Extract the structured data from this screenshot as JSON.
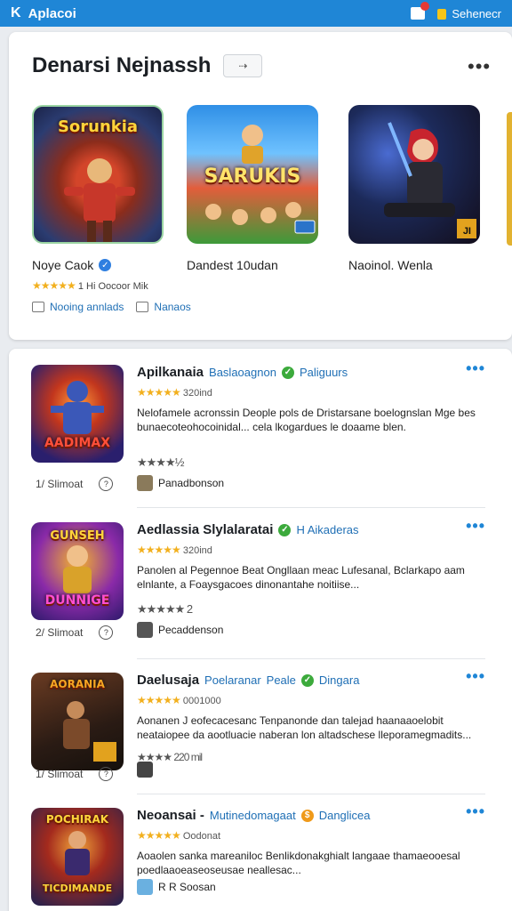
{
  "topbar": {
    "title": "Aplacoi",
    "right_label": "Sehenecr"
  },
  "featured": {
    "title": "Denarsi Nejnassh",
    "chip": "⇢",
    "games": [
      {
        "art_text": "Sorunkia",
        "name": "Noye Caok",
        "rating": "1 Hi Oocoor Mik"
      },
      {
        "art_text": "SARUKIS",
        "name": "Dandest 10udan",
        "rating": ""
      },
      {
        "art_text": "",
        "name": "Naoinol. Wenla",
        "rating": ""
      }
    ],
    "links": [
      "Nooing annlads",
      "Nanaos"
    ]
  },
  "list": [
    {
      "art_text": "AADIMAX",
      "title": "Apilkanaia",
      "tag1": "Baslaoagnon",
      "tag2": "Paliguurs",
      "count": "320ind",
      "desc": "Nelofamele acronssin Deople pols de Dristarsane boelognslan Mge bes bunaecoteohocoinidal... cela lkogardues le doaame blen.",
      "rate2": "★★★★½",
      "author": "Panadbonson",
      "meta_left": "1/ Slimoat"
    },
    {
      "art_text": "DUNNIGE",
      "title": "Aedlassia Slylalaratai",
      "tag1": "",
      "tag2": "H Aikaderas",
      "count": "320ind",
      "desc": "Panolen al Pegennoe Beat Ongllaan meac Lufesanal, Bclarkapo aam elnlante, a Foaysgacoes dinonantahe noitiise...",
      "rate2": "★★★★★ 2",
      "author": "Pecaddenson",
      "meta_left": "2/ Slimoat"
    },
    {
      "art_text": "AORANIA",
      "title": "Daelusaja",
      "tag1": "Poelaranar",
      "tag2": "Peale",
      "tag3": "Dingara",
      "count": "0001000",
      "desc": "Aonanen J eofecacesanc Tenpanonde dan talejad haanaaoelobit neataiopee da aootluacie naberan lon altadschese lleporamegmadits...",
      "rate2": "★★★★ 220 mil",
      "author": "",
      "meta_left": "1/ Slimoat"
    },
    {
      "art_text": "TICDIMANDE",
      "title": "Neoansai -",
      "tag1": "Mutinedomagaat",
      "tag2": "Danglicea",
      "count": "Oodonat",
      "desc": "Aoaolen sanka mareaniloc Benlikdonakghialt langaae thamaeooesal poedlaaoeaseoseusae neallesac...",
      "rate2": "R R Soosan",
      "author": "",
      "meta_left": ""
    }
  ]
}
